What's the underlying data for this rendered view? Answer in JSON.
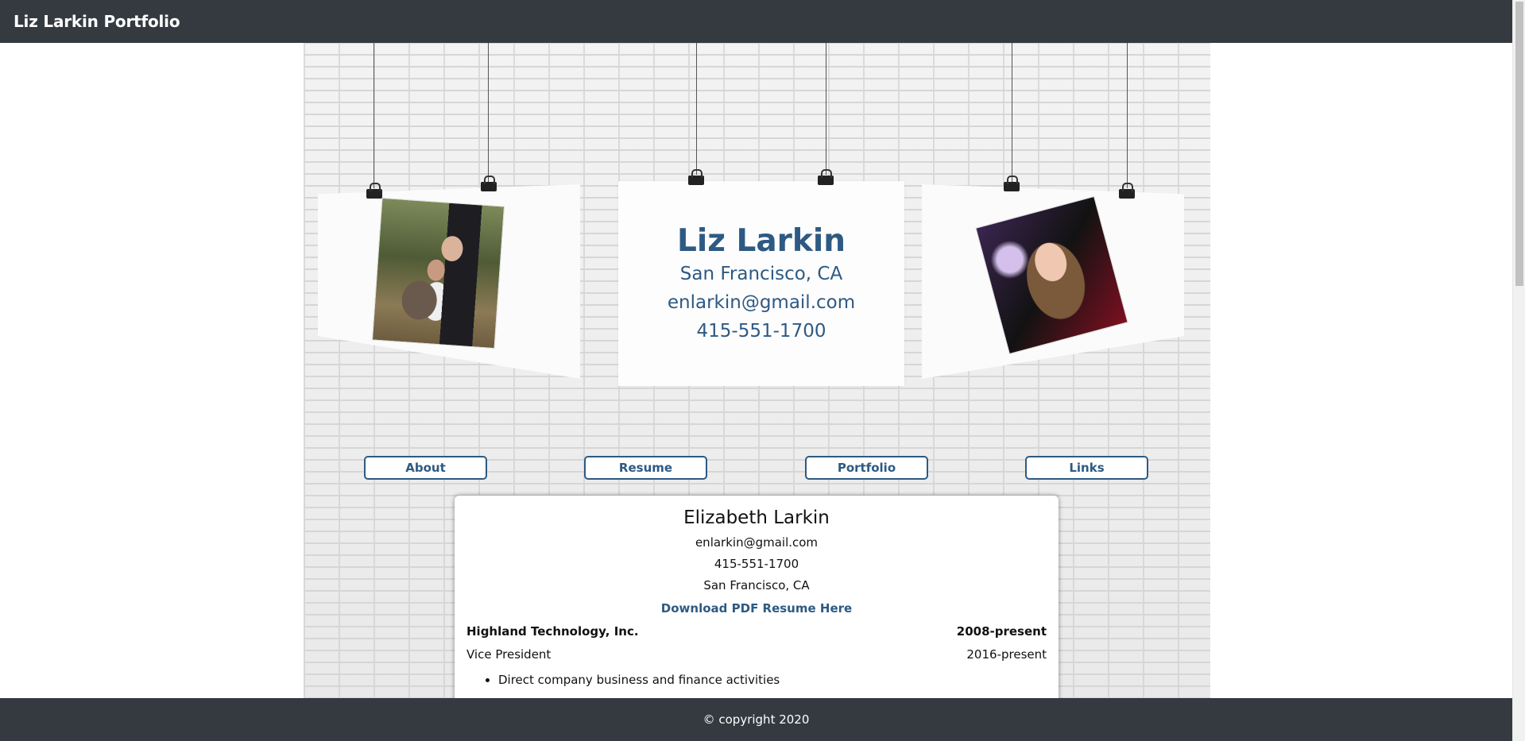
{
  "navbar": {
    "brand": "Liz Larkin Portfolio"
  },
  "hero": {
    "name": "Liz Larkin",
    "location": "San Francisco, CA",
    "email": "enlarkin@gmail.com",
    "phone": "415-551-1700"
  },
  "nav_buttons": [
    {
      "label": "About"
    },
    {
      "label": "Resume"
    },
    {
      "label": "Portfolio"
    },
    {
      "label": "Links"
    }
  ],
  "resume": {
    "name": "Elizabeth Larkin",
    "email": "enlarkin@gmail.com",
    "phone": "415-551-1700",
    "location": "San Francisco, CA",
    "download_label": "Download PDF Resume Here",
    "company": "Highland Technology, Inc.",
    "company_dates": "2008-present",
    "role": "Vice President",
    "role_dates": "2016-present",
    "bullets": [
      "Direct company business and finance activities"
    ]
  },
  "footer": {
    "text": "© copyright 2020"
  },
  "colors": {
    "accent": "#2d5a83",
    "bar": "#343a40"
  }
}
